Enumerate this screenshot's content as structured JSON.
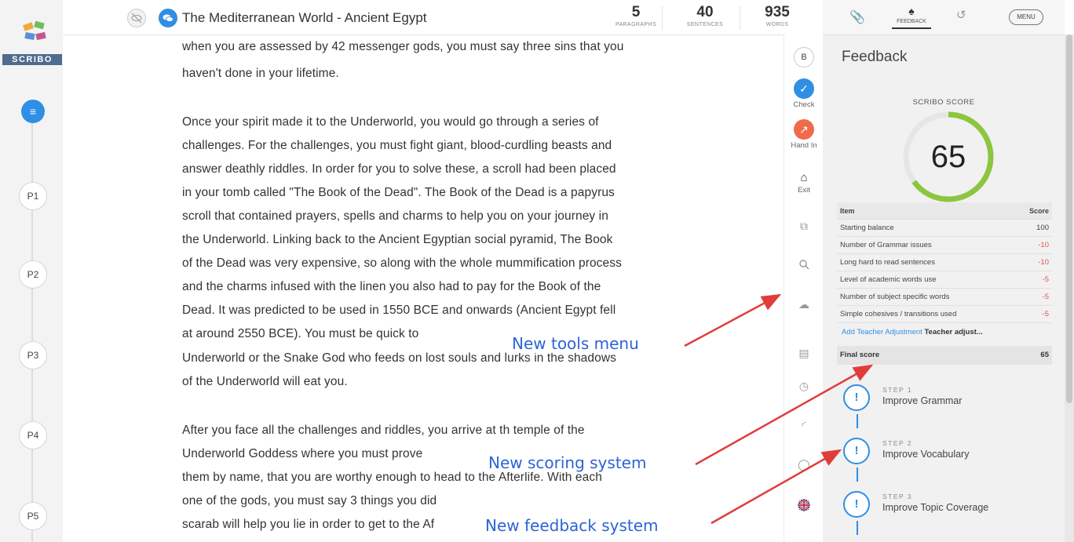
{
  "app": {
    "logo_text": "SCRIBO"
  },
  "rail": {
    "nodes": [
      "P1",
      "P2",
      "P3",
      "P4",
      "P5"
    ]
  },
  "header": {
    "title": "The Mediterranean World - Ancient Egypt",
    "stats": [
      {
        "value": "5",
        "label": "PARAGRAPHS"
      },
      {
        "value": "40",
        "label": "SENTENCES"
      },
      {
        "value": "935",
        "label": "WORDS"
      }
    ]
  },
  "editor": {
    "lines": [
      "when you are assessed by 42 messenger gods, you must say three sins that you",
      "haven't done in your lifetime.",
      "Once your spirit made it to the Underworld, you would go through a series of",
      "challenges. For the challenges, you must fight giant, blood-curdling beasts and",
      "answer deathly riddles. In order for you to solve these, a scroll had been placed",
      "in your tomb called \"The Book of the Dead\". The Book of the Dead is a papyrus",
      "scroll that contained prayers, spells and charms to help you on your journey in",
      "the Underworld. Linking back to the Ancient Egyptian social pyramid, The Book",
      "of the Dead was very expensive, so along with the whole mummification process",
      "and the charms infused with the linen you also had to pay for the Book of the",
      "Dead. It was predicted to be used in 1550 BCE and onwards (Ancient Egypt fell",
      "at around 2550 BCE). You must be quick to",
      "Underworld or the Snake God who feeds on lost souls and lurks in the shadows",
      "of the Underworld will eat you.",
      "After you face all the challenges and riddles, you arrive at th temple of the",
      "Underworld Goddess where you must prove",
      "them by name, that you are worthy enough to head to the Afterlife. With each",
      "one of the gods, you must say 3 things you did",
      "scarab will help you lie in order to get to the Af"
    ]
  },
  "tools": {
    "bold_label": "B",
    "check_label": "Check",
    "handin_label": "Hand In",
    "exit_label": "Exit"
  },
  "panel": {
    "menu_label": "MENU",
    "feedback_tab_label": "FEEDBACK",
    "title": "Feedback",
    "score_label": "SCRIBO SCORE",
    "score": "65",
    "score_fraction": 0.65,
    "table_headers": [
      "Item",
      "Score"
    ],
    "rows": [
      {
        "item": "Starting balance",
        "score": "100"
      },
      {
        "item": "Number of Grammar issues",
        "score": "-10"
      },
      {
        "item": "Long hard to read sentences",
        "score": "-10"
      },
      {
        "item": "Level of academic words use",
        "score": "-5"
      },
      {
        "item": "Number of subject specific words",
        "score": "-5"
      },
      {
        "item": "Simple cohesives / transitions used",
        "score": "-5"
      }
    ],
    "teacher_link": "Add Teacher Adjustment",
    "teacher_adjust": "Teacher adjust...",
    "final_label": "Final score",
    "final_score": "65",
    "steps": [
      {
        "num": "STEP 1",
        "name": "Improve Grammar"
      },
      {
        "num": "STEP 2",
        "name": "Improve Vocabulary"
      },
      {
        "num": "STEP 3",
        "name": "Improve Topic Coverage"
      }
    ]
  },
  "annotations": {
    "tools_menu": "New tools menu",
    "scoring": "New scoring system",
    "feedback": "New feedback system"
  },
  "colors": {
    "accent": "#2f8fe4",
    "score_ring": "#8cc63f",
    "annotation": "#2d63d6",
    "arrow": "#e03c3c",
    "negative": "#e25555"
  }
}
